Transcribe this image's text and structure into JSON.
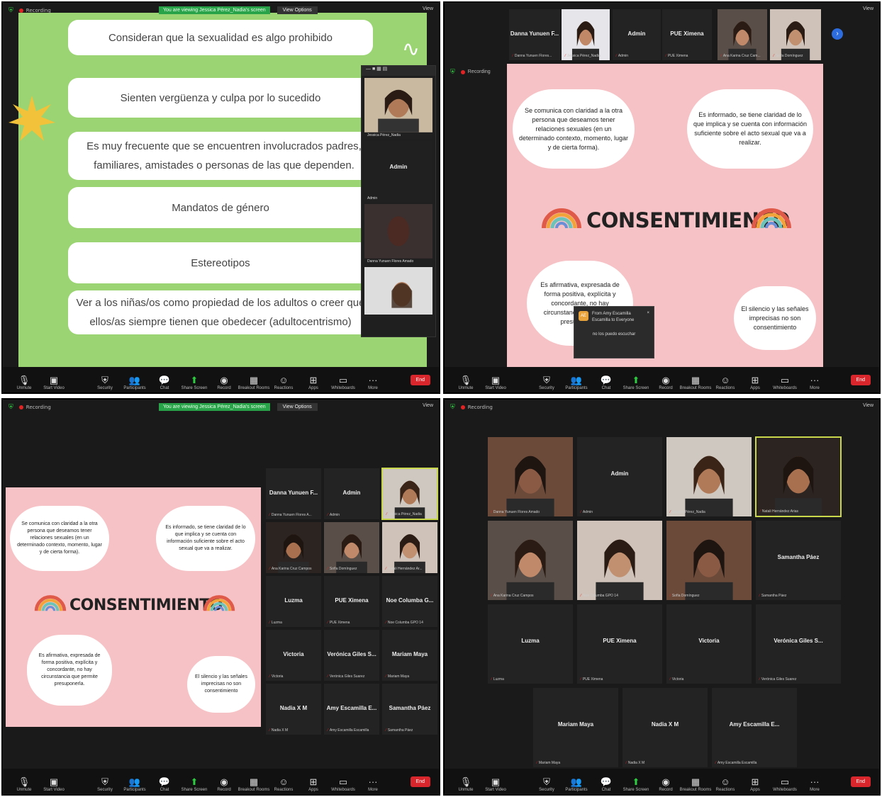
{
  "common": {
    "recording": "Recording",
    "view": "View",
    "toolbar": [
      "Unmute",
      "Start Video",
      "Security",
      "Participants",
      "Chat",
      "Share Screen",
      "Record",
      "Breakout Rooms",
      "Reactions",
      "Apps",
      "Whiteboards",
      "More"
    ],
    "end": "End",
    "viewing_banner": "You are viewing Jessica Pérez_Nadia's screen",
    "view_options": "View Options"
  },
  "q1": {
    "boxes": [
      "Consideran que la sexualidad es algo prohibido",
      "Sienten vergüenza y culpa por lo sucedido",
      "Es muy frecuente que se encuentren involucrados padres, familiares, amistades o personas de las que dependen.",
      "Mandatos de género",
      "Estereotipos",
      "Ver a los niñas/os como propiedad de los adultos o creer que ellos/as siempre tienen que obedecer (adultocentrismo)"
    ],
    "thumbs": [
      "Jessica Pérez_Nadia",
      "Admin",
      "Danna Yunuen Flores Amado"
    ]
  },
  "slide": {
    "title": "CONSENTIMIENTO",
    "c1": "Se comunica con claridad a la otra persona que deseamos tener relaciones sexuales (en un determinado contexto, momento, lugar y de cierta forma).",
    "c2": "Es informado, se tiene claridad de lo que implica y se cuenta con información suficiente sobre el acto sexual que va a realizar.",
    "c3": "Es afirmativa, expresada de forma positiva, explícita y concordante, no hay circunstancia que permite presuponerla.",
    "c4": "El silencio y las señales imprecisas no son consentimiento"
  },
  "q2": {
    "strip": [
      {
        "name": "Danna Yunuen F...",
        "sub": "Danna Yunuen Flores..."
      },
      {
        "name": "",
        "sub": "Jessica Pérez_Nadia"
      },
      {
        "name": "Admin",
        "sub": "Admin"
      },
      {
        "name": "PUE Ximena",
        "sub": "PUE Ximena"
      },
      {
        "name": "",
        "sub": "Ana Karina Cruz Cam..."
      },
      {
        "name": "",
        "sub": "Sofía Domínguez"
      }
    ],
    "chat_from": "From Amy Escamilla Escamilla to Everyone",
    "chat_msg": "no los puedo escuchar",
    "chat_initials": "AE"
  },
  "q3": {
    "grid": [
      {
        "name": "Danna Yunuen F...",
        "sub": "Danna Yunuen Flores A..."
      },
      {
        "name": "Admin",
        "sub": "Admin"
      },
      {
        "name": "",
        "sub": "Jessica Pérez_Nadia"
      },
      {
        "name": "",
        "sub": "Ana Karina Cruz Campos"
      },
      {
        "name": "",
        "sub": "Sofía Domínguez"
      },
      {
        "name": "",
        "sub": "Natali Hernández Ar..."
      },
      {
        "name": "Luzma",
        "sub": "Luzma"
      },
      {
        "name": "PUE Ximena",
        "sub": "PUE Ximena"
      },
      {
        "name": "Noe Columba G...",
        "sub": "Noe Columba GPO 14"
      },
      {
        "name": "Victoria",
        "sub": "Victoria"
      },
      {
        "name": "Verónica Giles S...",
        "sub": "Verónica Giles Suarez"
      },
      {
        "name": "Mariam Maya",
        "sub": "Mariam Maya"
      },
      {
        "name": "Nadia X M",
        "sub": "Nadia X M"
      },
      {
        "name": "Amy Escamilla E...",
        "sub": "Amy Escamilla Escamilla"
      },
      {
        "name": "Samantha Páez",
        "sub": "Samantha Páez"
      }
    ]
  },
  "q4": {
    "grid": [
      {
        "name": "",
        "sub": "Danna Yunuen Flores Amado"
      },
      {
        "name": "Admin",
        "sub": "Admin"
      },
      {
        "name": "",
        "sub": "Jessica Pérez_Nadia"
      },
      {
        "name": "",
        "sub": "Natali Hernández Arias"
      },
      {
        "name": "",
        "sub": "Ana Karina Cruz Campos"
      },
      {
        "name": "",
        "sub": "Noe Columba GPO 14"
      },
      {
        "name": "",
        "sub": "Sofía Domínguez"
      },
      {
        "name": "Samantha Páez",
        "sub": "Samantha Páez"
      },
      {
        "name": "Luzma",
        "sub": "Luzma"
      },
      {
        "name": "PUE Ximena",
        "sub": "PUE Ximena"
      },
      {
        "name": "Victoria",
        "sub": "Victoria"
      },
      {
        "name": "Verónica Giles S...",
        "sub": "Verónica Giles Suarez"
      },
      {
        "name": "Mariam Maya",
        "sub": "Mariam Maya"
      },
      {
        "name": "Nadia X M",
        "sub": "Nadia X M"
      },
      {
        "name": "Amy Escamilla E...",
        "sub": "Amy Escamilla Escamilla"
      }
    ]
  }
}
